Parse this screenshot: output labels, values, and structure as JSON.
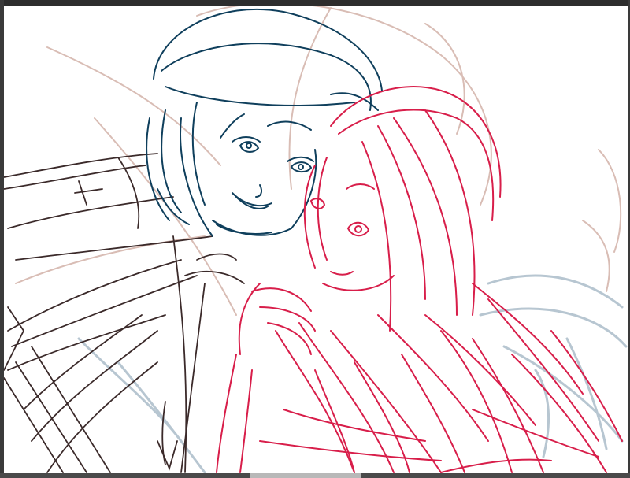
{
  "app": {
    "view": "drawing-canvas"
  },
  "canvas": {
    "background": "#ffffff",
    "frame_color": "#3a3a3a"
  },
  "layers": [
    {
      "name": "rough",
      "color": "#d9bdb5",
      "visible": true
    },
    {
      "name": "man-head",
      "color": "#0f3f5c",
      "visible": true
    },
    {
      "name": "man-body",
      "color": "#3b2a2a",
      "visible": true
    },
    {
      "name": "woman",
      "color": "#d81e4a",
      "visible": true
    },
    {
      "name": "background-blue",
      "color": "#b7c6d1",
      "visible": true
    }
  ],
  "scrollbar": {
    "horizontal": true
  }
}
